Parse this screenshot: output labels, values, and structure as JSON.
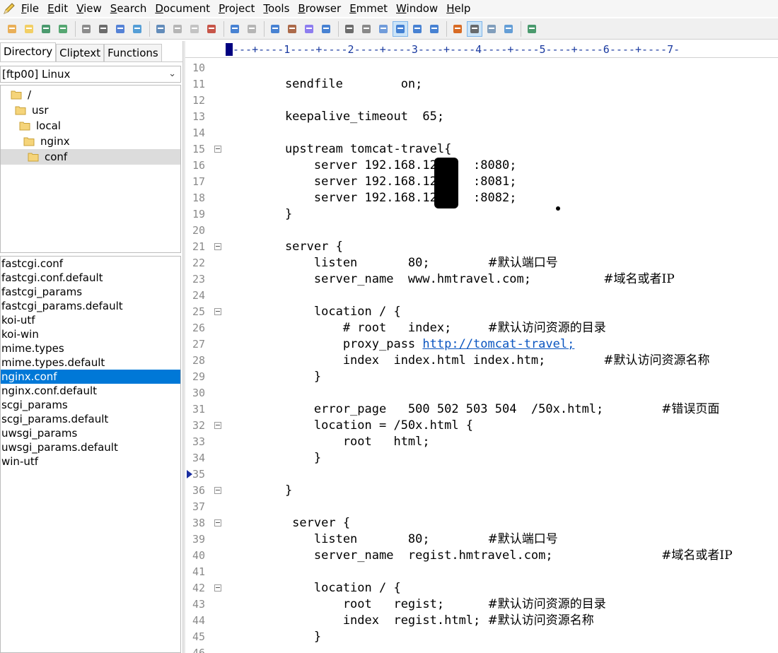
{
  "menu": {
    "items": [
      {
        "key": "F",
        "rest": "ile"
      },
      {
        "key": "E",
        "rest": "dit"
      },
      {
        "key": "V",
        "rest": "iew"
      },
      {
        "key": "S",
        "rest": "earch"
      },
      {
        "key": "D",
        "rest": "ocument"
      },
      {
        "key": "P",
        "rest": "roject"
      },
      {
        "key": "T",
        "rest": "ools"
      },
      {
        "key": "B",
        "rest": "rowser"
      },
      {
        "key": "E",
        "rest": "mmet"
      },
      {
        "key": "W",
        "rest": "indow"
      },
      {
        "key": "H",
        "rest": "elp"
      }
    ]
  },
  "toolbar": {
    "icons": [
      "new-file-icon",
      "open-folder-icon",
      "save-icon",
      "save-all-icon",
      "separator",
      "print-preview-icon",
      "print-icon",
      "spell-check-icon",
      "reload-icon",
      "separator",
      "cut-icon",
      "copy-icon",
      "paste-icon",
      "delete-icon",
      "separator",
      "undo-icon",
      "redo-icon",
      "separator",
      "find-icon",
      "replace-icon",
      "find-in-files-icon",
      "goto-icon",
      "separator",
      "font-icon",
      "hex-icon",
      "word-wrap-icon",
      "column-icon",
      "ruler-icon",
      "spell-icon",
      "separator",
      "list-icon",
      "view-icon",
      "preview-icon",
      "browser-icon",
      "separator",
      "help-icon"
    ],
    "accent": "#2a6fcc"
  },
  "left": {
    "tabs": [
      "Directory",
      "Cliptext",
      "Functions"
    ],
    "active_tab": "Directory",
    "drive": "[ftp00] Linux",
    "tree": [
      "/",
      "usr",
      "local",
      "nginx",
      "conf"
    ],
    "selected_folder": "conf",
    "files": [
      "fastcgi.conf",
      "fastcgi.conf.default",
      "fastcgi_params",
      "fastcgi_params.default",
      "koi-utf",
      "koi-win",
      "mime.types",
      "mime.types.default",
      "nginx.conf",
      "nginx.conf.default",
      "scgi_params",
      "scgi_params.default",
      "uwsgi_params",
      "uwsgi_params.default",
      "win-utf"
    ],
    "selected_file": "nginx.conf"
  },
  "editor": {
    "ruler": "---+----1----+----2----+----3----+----4----+----5----+----6----+----7-",
    "first_line": 10,
    "current_line": 35,
    "lines": [
      {
        "n": "10",
        "text": ""
      },
      {
        "n": "11",
        "text": "    sendfile        on;"
      },
      {
        "n": "12",
        "text": ""
      },
      {
        "n": "13",
        "text": "    keepalive_timeout  65;"
      },
      {
        "n": "14",
        "text": ""
      },
      {
        "n": "15",
        "text": "    upstream tomcat-travel{",
        "fold": true
      },
      {
        "n": "16",
        "text": "        server 192.168.120.   :8080;"
      },
      {
        "n": "17",
        "text": "        server 192.168.120.   :8081;"
      },
      {
        "n": "18",
        "text": "        server 192.168.120.   :8082;"
      },
      {
        "n": "19",
        "text": "    }"
      },
      {
        "n": "20",
        "text": ""
      },
      {
        "n": "21",
        "text": "    server {",
        "fold": true
      },
      {
        "n": "22",
        "text": "        listen       80;        ",
        "comment": "#默认端口号"
      },
      {
        "n": "23",
        "text": "        server_name  www.hmtravel.com;          ",
        "comment": "#域名或者IP"
      },
      {
        "n": "24",
        "text": ""
      },
      {
        "n": "25",
        "text": "        location / {",
        "fold": true
      },
      {
        "n": "26",
        "text": "            # root   index;     ",
        "comment": "#默认访问资源的目录"
      },
      {
        "n": "27",
        "text": "            proxy_pass ",
        "link": "http://tomcat-travel;"
      },
      {
        "n": "28",
        "text": "            index  index.html index.htm;        ",
        "comment": "#默认访问资源名称"
      },
      {
        "n": "29",
        "text": "        }"
      },
      {
        "n": "30",
        "text": ""
      },
      {
        "n": "31",
        "text": "        error_page   500 502 503 504  /50x.html;        ",
        "comment": "#错误页面"
      },
      {
        "n": "32",
        "text": "        location = /50x.html {",
        "fold": true
      },
      {
        "n": "33",
        "text": "            root   html;"
      },
      {
        "n": "34",
        "text": "        }"
      },
      {
        "n": "35",
        "text": ""
      },
      {
        "n": "36",
        "text": "    }",
        "fold": true
      },
      {
        "n": "37",
        "text": ""
      },
      {
        "n": "38",
        "text": "     server {",
        "fold": true
      },
      {
        "n": "39",
        "text": "        listen       80;        ",
        "comment": "#默认端口号"
      },
      {
        "n": "40",
        "text": "        server_name  regist.hmtravel.com;               ",
        "comment": "#域名或者IP"
      },
      {
        "n": "41",
        "text": ""
      },
      {
        "n": "42",
        "text": "        location / {",
        "fold": true
      },
      {
        "n": "43",
        "text": "            root   regist;      ",
        "comment": "#默认访问资源的目录"
      },
      {
        "n": "44",
        "text": "            index  regist.html; ",
        "comment": "#默认访问资源名称"
      },
      {
        "n": "45",
        "text": "        }"
      },
      {
        "n": "46",
        "text": ""
      }
    ]
  }
}
